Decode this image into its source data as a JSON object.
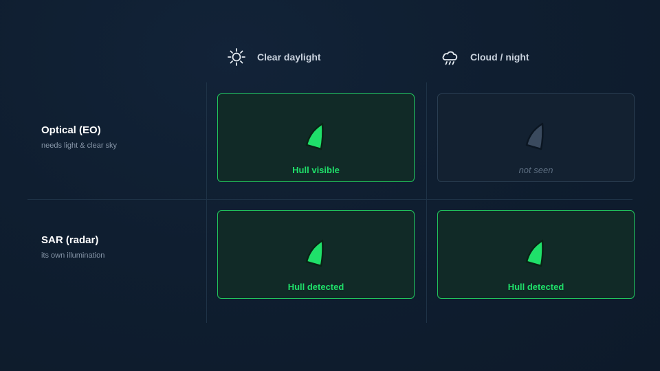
{
  "columns": [
    {
      "label": "Clear daylight",
      "icon": "sun-icon"
    },
    {
      "label": "Cloud / night",
      "icon": "cloud-rain-icon"
    }
  ],
  "rows": [
    {
      "title": "Optical (EO)",
      "subtitle": "needs light & clear sky"
    },
    {
      "title": "SAR (radar)",
      "subtitle": "its own illumination"
    }
  ],
  "cells": {
    "eo_day": {
      "status": "Hull visible",
      "detected": true
    },
    "eo_night": {
      "status": "not seen",
      "detected": false
    },
    "sar_day": {
      "status": "Hull detected",
      "detected": true
    },
    "sar_night": {
      "status": "Hull detected",
      "detected": true
    }
  },
  "colors": {
    "background": "#0f1e30",
    "detected": "#1fe06a",
    "not_detected": "#3a4a5e",
    "grid_line": "#1f3347"
  },
  "icons": {
    "ship": "ship-hull-icon"
  }
}
